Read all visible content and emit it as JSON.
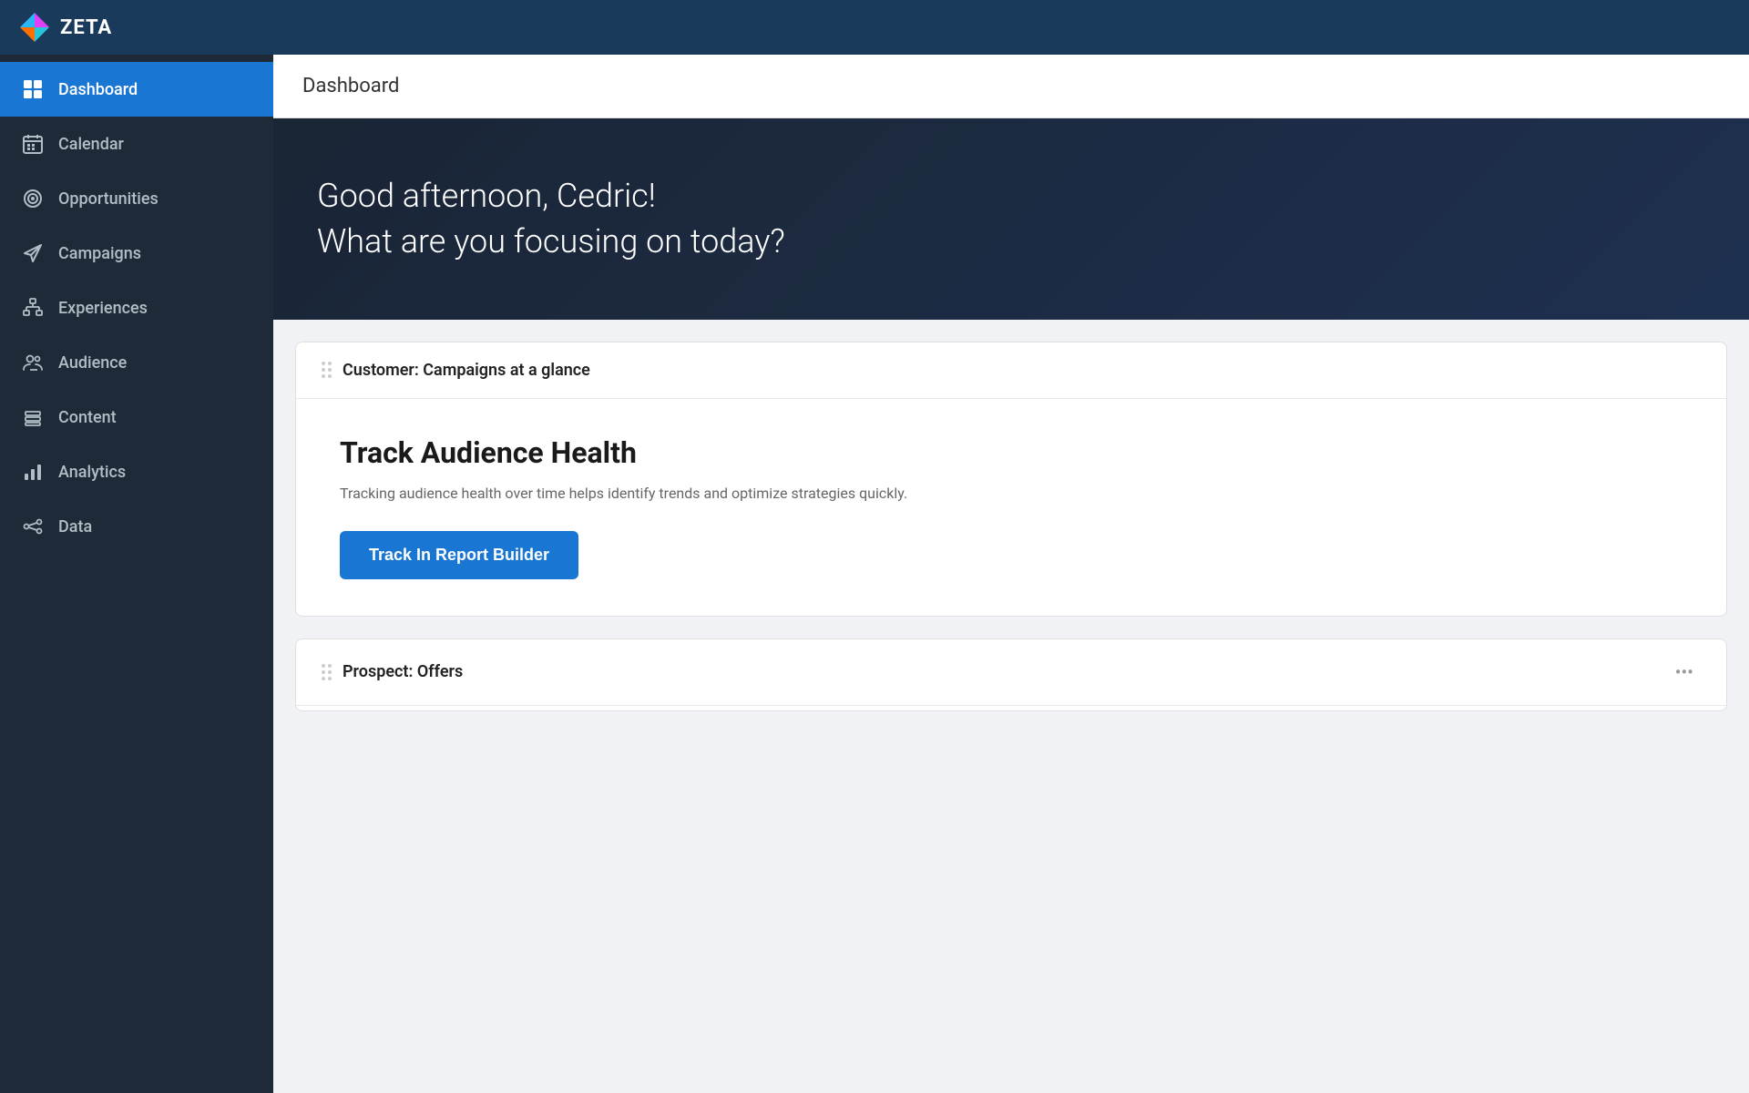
{
  "app": {
    "name": "ZETA"
  },
  "header": {
    "page_title": "Dashboard"
  },
  "sidebar": {
    "items": [
      {
        "id": "dashboard",
        "label": "Dashboard",
        "icon": "grid",
        "active": true
      },
      {
        "id": "calendar",
        "label": "Calendar",
        "icon": "calendar",
        "active": false
      },
      {
        "id": "opportunities",
        "label": "Opportunities",
        "icon": "target",
        "active": false
      },
      {
        "id": "campaigns",
        "label": "Campaigns",
        "icon": "send",
        "active": false
      },
      {
        "id": "experiences",
        "label": "Experiences",
        "icon": "hierarchy",
        "active": false
      },
      {
        "id": "audience",
        "label": "Audience",
        "icon": "users",
        "active": false
      },
      {
        "id": "content",
        "label": "Content",
        "icon": "layers",
        "active": false
      },
      {
        "id": "analytics",
        "label": "Analytics",
        "icon": "chart",
        "active": false
      },
      {
        "id": "data",
        "label": "Data",
        "icon": "data",
        "active": false
      }
    ]
  },
  "hero": {
    "greeting_line1": "Good afternoon, Cedric!",
    "greeting_line2": "What are you focusing on today?"
  },
  "cards": [
    {
      "id": "campaigns-glance",
      "title": "Customer: Campaigns at a glance",
      "body": {
        "track_title": "Track Audience Health",
        "track_description": "Tracking audience health over time helps identify trends and optimize strategies quickly.",
        "track_button_label": "Track In Report Builder"
      }
    },
    {
      "id": "offers",
      "title": "Prospect: Offers",
      "partial": true
    }
  ],
  "colors": {
    "sidebar_bg": "#1e2a38",
    "active_item": "#1976d2",
    "header_bg": "#1a3a5c",
    "hero_bg_start": "#1a2535",
    "hero_bg_end": "#1e3050",
    "btn_color": "#1976d2"
  }
}
